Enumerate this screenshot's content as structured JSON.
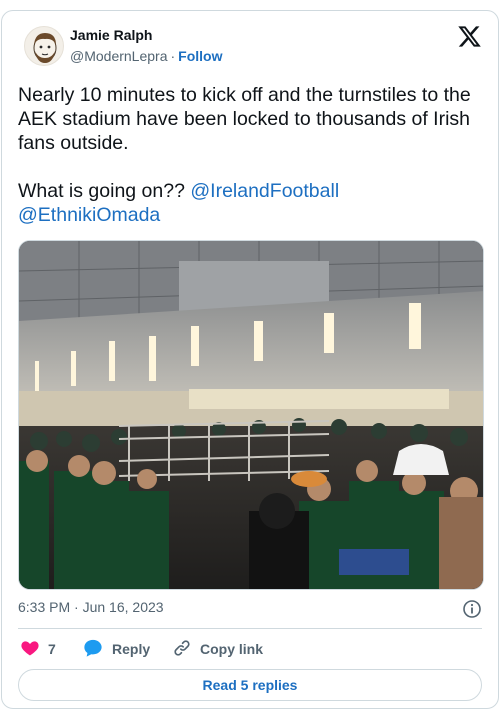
{
  "author": {
    "name": "Jamie Ralph",
    "handle": "@ModernLepra",
    "separator": "·",
    "follow_label": "Follow"
  },
  "tweet": {
    "line1": "Nearly 10 minutes to kick off and the turnstiles to the AEK stadium have been locked to thousands of Irish fans outside.",
    "line2_prefix": "What is going on?? ",
    "mention1": "@IrelandFootball",
    "mention2": "@EthnikiOmada"
  },
  "meta": {
    "time": "6:33 PM",
    "separator": "·",
    "date": "Jun 16, 2023"
  },
  "actions": {
    "like_count": "7",
    "reply_label": "Reply",
    "copy_label": "Copy link"
  },
  "read_replies_label": "Read 5 replies",
  "colors": {
    "link": "#1d6fc1",
    "like": "#f91880",
    "text": "#0f1419",
    "muted": "#536471",
    "border": "#cfd9de"
  },
  "icons": [
    "x-logo-icon",
    "heart-icon",
    "reply-bubble-icon",
    "link-icon",
    "info-icon"
  ]
}
